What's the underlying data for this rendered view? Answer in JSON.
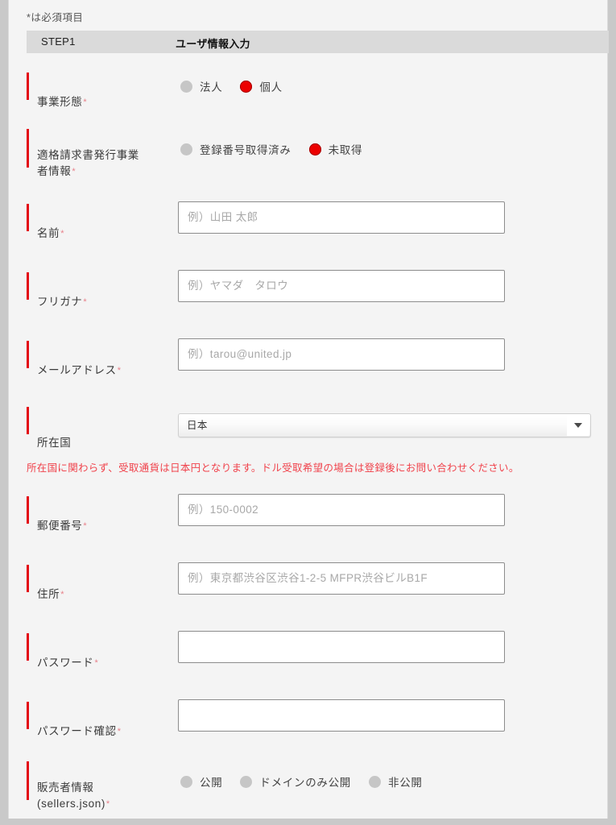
{
  "form": {
    "required_note": "*は必須項目",
    "step": {
      "number": "STEP1",
      "title": "ユーザ情報入力"
    },
    "business_type": {
      "label": "事業形態",
      "required": "*",
      "options": [
        {
          "label": "法人",
          "selected": false
        },
        {
          "label": "個人",
          "selected": true
        }
      ]
    },
    "invoice_issuer": {
      "label": "適格請求書発行事業\n者情報",
      "required": "*",
      "options": [
        {
          "label": "登録番号取得済み",
          "selected": false
        },
        {
          "label": "未取得",
          "selected": true
        }
      ]
    },
    "name": {
      "label": "名前",
      "required": "*",
      "placeholder": "例）山田 太郎",
      "value": ""
    },
    "furigana": {
      "label": "フリガナ",
      "required": "*",
      "placeholder": "例）ヤマダ　タロウ",
      "value": ""
    },
    "email": {
      "label": "メールアドレス",
      "required": "*",
      "placeholder": "例）tarou@united.jp",
      "value": ""
    },
    "country": {
      "label": "所在国",
      "required": "",
      "selected": "日本",
      "options": [
        "日本"
      ]
    },
    "currency_note": "所在国に関わらず、受取通貨は日本円となります。ドル受取希望の場合は登録後にお問い合わせください。",
    "postal_code": {
      "label": "郵便番号",
      "required": "*",
      "placeholder": "例）150-0002",
      "value": ""
    },
    "address": {
      "label": "住所",
      "required": "*",
      "placeholder": "例）東京都渋谷区渋谷1-2-5 MFPR渋谷ビルB1F",
      "value": ""
    },
    "password": {
      "label": "パスワード",
      "required": "*",
      "placeholder": "",
      "value": ""
    },
    "password_confirm": {
      "label": "パスワード確認",
      "required": "*",
      "placeholder": "",
      "value": ""
    },
    "sellers_json": {
      "label": "販売者情報\n(sellers.json)",
      "required": "*",
      "options": [
        {
          "label": "公開",
          "selected": false
        },
        {
          "label": "ドメインのみ公開",
          "selected": false
        },
        {
          "label": "非公開",
          "selected": false
        }
      ]
    }
  },
  "colors": {
    "accent_red": "#e30613",
    "radio_selected": "#ec0000",
    "radio_unselected": "#c6c6c6",
    "note_red": "#f0424b",
    "step_band": "#dadada",
    "card_bg": "#f4f4f4",
    "page_bg": "#c9c9c9"
  }
}
